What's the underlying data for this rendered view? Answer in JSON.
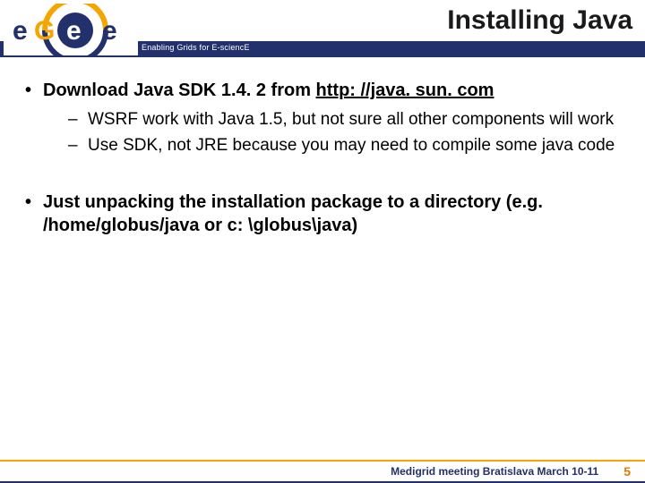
{
  "header": {
    "title": "Installing Java",
    "tagline": "Enabling Grids for E-sciencE"
  },
  "logo": {
    "letters": {
      "e1": "e",
      "g": "G",
      "e2": "e",
      "e3": "e"
    }
  },
  "bullets": {
    "b1_prefix": "Download Java SDK 1.4. 2 from ",
    "b1_url": "http: //java. sun. com",
    "b1_sub1": "WSRF work with Java 1.5, but not sure all other components will work",
    "b1_sub2": "Use SDK, not JRE because you may need to compile some java code",
    "b2": "Just unpacking the installation package to a directory (e.g. /home/globus/java or c: \\globus\\java)"
  },
  "footer": {
    "text": "Medigrid meeting Bratislava March 10-11",
    "page": "5"
  }
}
